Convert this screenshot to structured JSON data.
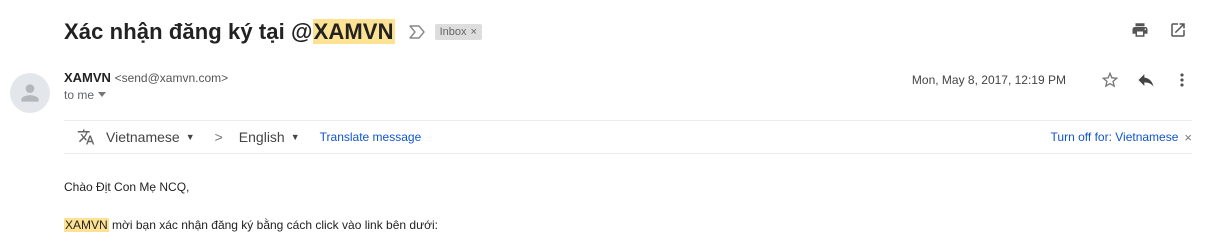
{
  "subject": {
    "prefix": "Xác nhận đăng ký tại @",
    "highlight": "XAMVN"
  },
  "label_chip": {
    "text": "Inbox",
    "close": "×"
  },
  "sender": {
    "name": "XAMVN",
    "email": "<send@xamvn.com>",
    "to": "to me"
  },
  "date": "Mon, May 8, 2017, 12:19 PM",
  "translate": {
    "from_lang": "Vietnamese",
    "to_lang": "English",
    "separator": ">",
    "translate_link": "Translate message",
    "turn_off": "Turn off for: Vietnamese",
    "close": "×"
  },
  "body": {
    "greeting": "Chào Địt Con Mẹ NCQ,",
    "line2_highlight": "XAMVN",
    "line2_rest": " mời bạn xác nhận đăng ký bằng cách click vào link bên dưới:"
  },
  "icons": {
    "importance": "importance-marker-icon",
    "print": "print-icon",
    "new_window": "open-in-new-window-icon",
    "avatar": "person-icon",
    "star": "star-icon",
    "reply": "reply-icon",
    "more": "more-vert-icon",
    "translate": "translate-icon"
  },
  "colors": {
    "highlight": "#fde293",
    "link": "#1155cc"
  }
}
